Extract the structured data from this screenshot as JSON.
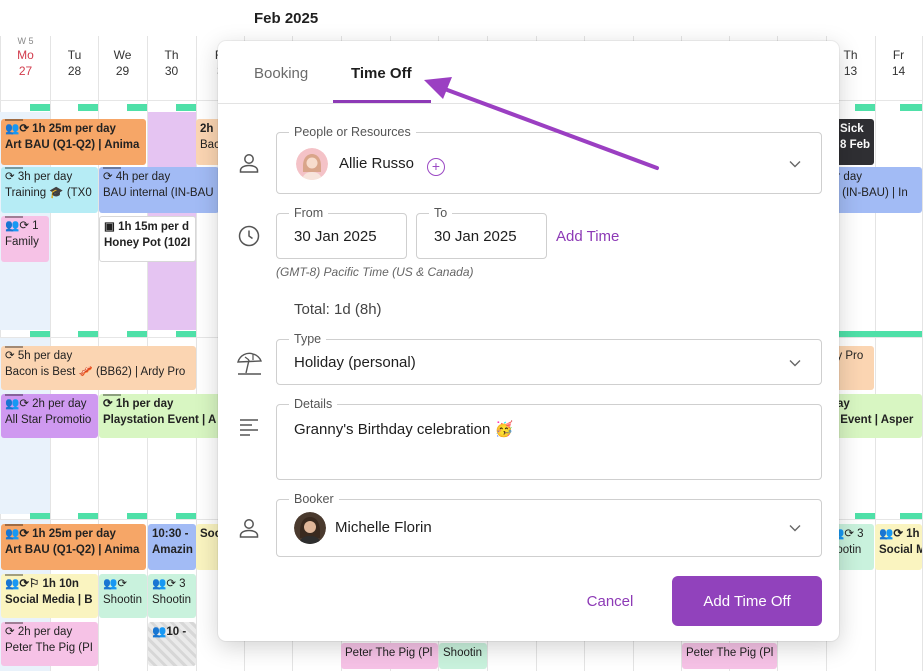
{
  "calendar": {
    "month_label": "Feb 2025",
    "week_label": "W 5",
    "days": [
      {
        "name": "Mo",
        "date": "27"
      },
      {
        "name": "Tu",
        "date": "28"
      },
      {
        "name": "We",
        "date": "29"
      },
      {
        "name": "Th",
        "date": "30"
      },
      {
        "name": "Fr",
        "date": "3"
      },
      {
        "name": "Th",
        "date": "13"
      },
      {
        "name": "Fr",
        "date": "14"
      }
    ],
    "events": [
      {
        "l1": "1h 25m per day",
        "l2": "Art BAU (Q1-Q2) | Anima"
      },
      {
        "l1": "2h",
        "l2": "Bac"
      },
      {
        "l1": "Sick",
        "l2": "8 Feb"
      },
      {
        "l1": "3h per day",
        "l2": "Training 🎓 (TX0"
      },
      {
        "l1": "4h per day",
        "l2": "BAU internal (IN-BAU"
      },
      {
        "l1": "er day",
        "l2": "al (IN-BAU) | In"
      },
      {
        "l1": "1",
        "l2": "Family"
      },
      {
        "l1": "1h 15m per d",
        "l2": "Honey Pot (102I"
      },
      {
        "l1": "5h per day",
        "l2": "Bacon is Best 🥓 (BB62) | Ardy Pro"
      },
      {
        "l1": "",
        "l2": "dy Pro"
      },
      {
        "l1": "2h per day",
        "l2": "All Star Promotio"
      },
      {
        "l1": "1h per day",
        "l2": "Playstation Event | A"
      },
      {
        "l1": "day",
        "l2": "n Event | Asper"
      },
      {
        "l1": "1h 25m per day",
        "l2": "Art BAU (Q1-Q2) | Anima"
      },
      {
        "l1": "10:30 -",
        "l2": "Amazin"
      },
      {
        "l1": "",
        "l2": "Soc"
      },
      {
        "l1": "3",
        "l2": "hootin"
      },
      {
        "l1": "1h",
        "l2": "Social M"
      },
      {
        "l1": "1h 10n",
        "l2": "Social Media | B"
      },
      {
        "l1": "",
        "l2": "Shootin"
      },
      {
        "l1": "3",
        "l2": "Shootin"
      },
      {
        "l1": "2h per day",
        "l2": "Peter The Pig (PI"
      },
      {
        "l1": "10 -",
        "l2": ""
      },
      {
        "l1": "",
        "l2": "Peter The Pig (Pl"
      },
      {
        "l1": "",
        "l2": "Shootin"
      },
      {
        "l1": "",
        "l2": "Peter The Pig (Pl"
      }
    ]
  },
  "modal": {
    "tabs": [
      "Booking",
      "Time Off"
    ],
    "active_tab": "Time Off",
    "people": {
      "label": "People or Resources",
      "value": "Allie Russo",
      "add_symbol": "+"
    },
    "from": {
      "label": "From",
      "value": "30 Jan 2025"
    },
    "to": {
      "label": "To",
      "value": "30 Jan 2025"
    },
    "add_time": "Add Time",
    "timezone": "(GMT-8) Pacific Time (US & Canada)",
    "total": "Total: 1d (8h)",
    "type": {
      "label": "Type",
      "value": "Holiday (personal)"
    },
    "details": {
      "label": "Details",
      "value": "Granny's Birthday celebration 🥳"
    },
    "booker": {
      "label": "Booker",
      "value": "Michelle Florin"
    },
    "cancel": "Cancel",
    "submit": "Add Time Off"
  },
  "colors": {
    "accent": "#9142bc",
    "today": "#d23b4c",
    "capacity_mark": "#4fe0a8",
    "annotation_arrow": "#9b3fc2"
  },
  "icons": [
    "person-icon",
    "clock-icon",
    "beach-umbrella-icon",
    "text-lines-icon",
    "chevron-down-icon",
    "plus-circle-icon"
  ]
}
